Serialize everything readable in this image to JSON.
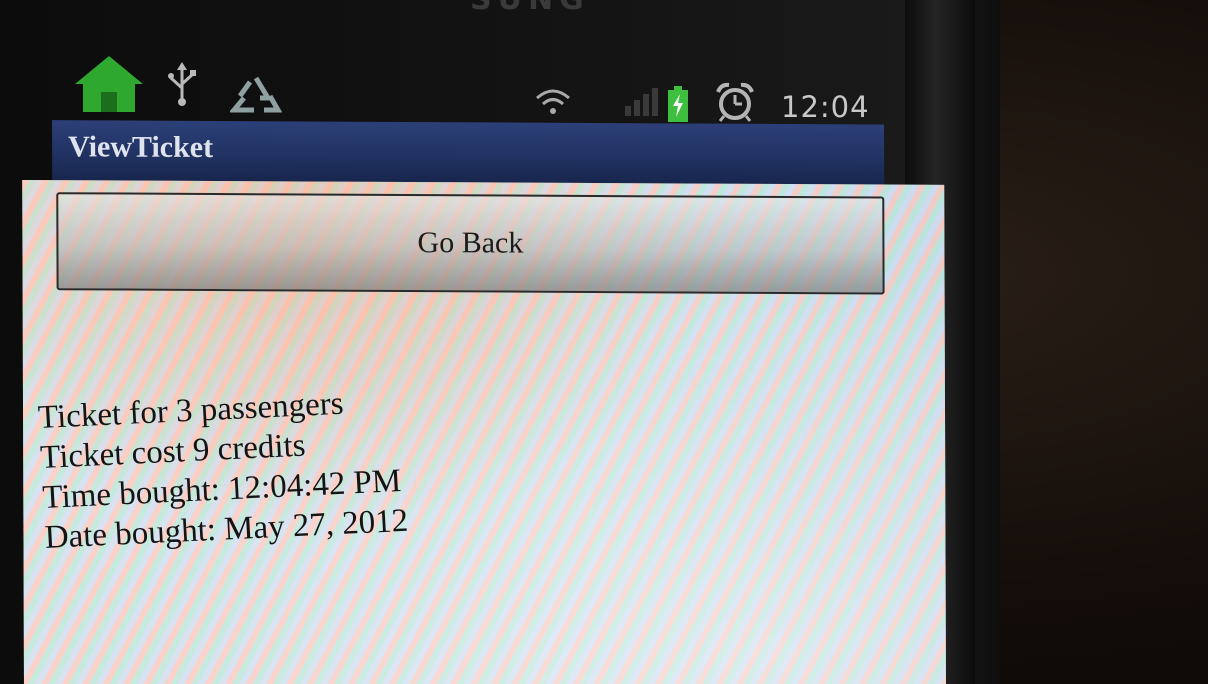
{
  "status_bar": {
    "time": "12:04",
    "icons": [
      "home-icon",
      "usb-icon",
      "recycle-icon",
      "wifi-icon",
      "signal-icon",
      "battery-charging-icon",
      "alarm-icon"
    ],
    "accent_home": "#2fa82f",
    "battery_color": "#3fbf3f"
  },
  "app": {
    "title": "ViewTicket",
    "title_bar_color": "#213363",
    "go_back_label": "Go Back",
    "details": [
      "Ticket for 3 passengers",
      "Ticket cost 9 credits",
      "Time bought: 12:04:42 PM",
      "Date bought: May 27, 2012"
    ]
  }
}
